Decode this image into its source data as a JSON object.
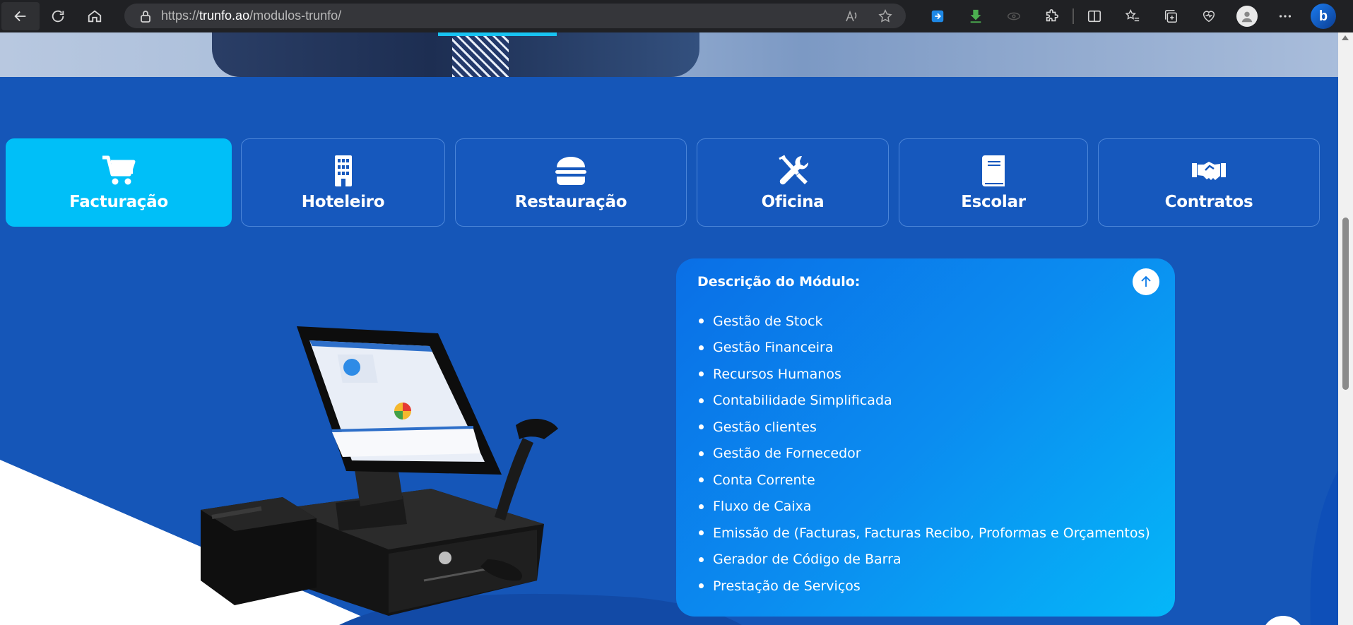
{
  "browser": {
    "url_prefix": "https://",
    "url_domain": "trunfo.ao",
    "url_path": "/modulos-trunfo/"
  },
  "tabs": [
    {
      "label": "Facturação",
      "icon": "shopping-cart-icon",
      "active": true
    },
    {
      "label": "Hoteleiro",
      "icon": "building-icon",
      "active": false
    },
    {
      "label": "Restauração",
      "icon": "burger-icon",
      "active": false
    },
    {
      "label": "Oficina",
      "icon": "tools-icon",
      "active": false
    },
    {
      "label": "Escolar",
      "icon": "book-icon",
      "active": false
    },
    {
      "label": "Contratos",
      "icon": "handshake-icon",
      "active": false
    }
  ],
  "description": {
    "title": "Descrição do Módulo:",
    "items": [
      "Gestão de Stock",
      "Gestão Financeira",
      "Recursos Humanos",
      "Contabilidade Simplificada",
      "Gestão clientes",
      "Gestão de Fornecedor",
      "Conta Corrente",
      "Fluxo de Caixa",
      "Emissão de (Facturas, Facturas Recibo, Proformas e Orçamentos)",
      "Gerador de Código de Barra",
      "Prestação de Serviços"
    ]
  },
  "colors": {
    "page_bg": "#1556b8",
    "active_tab": "#00bff8",
    "card_gradient_start": "#0a6fe6",
    "card_gradient_end": "#05b7f8"
  }
}
